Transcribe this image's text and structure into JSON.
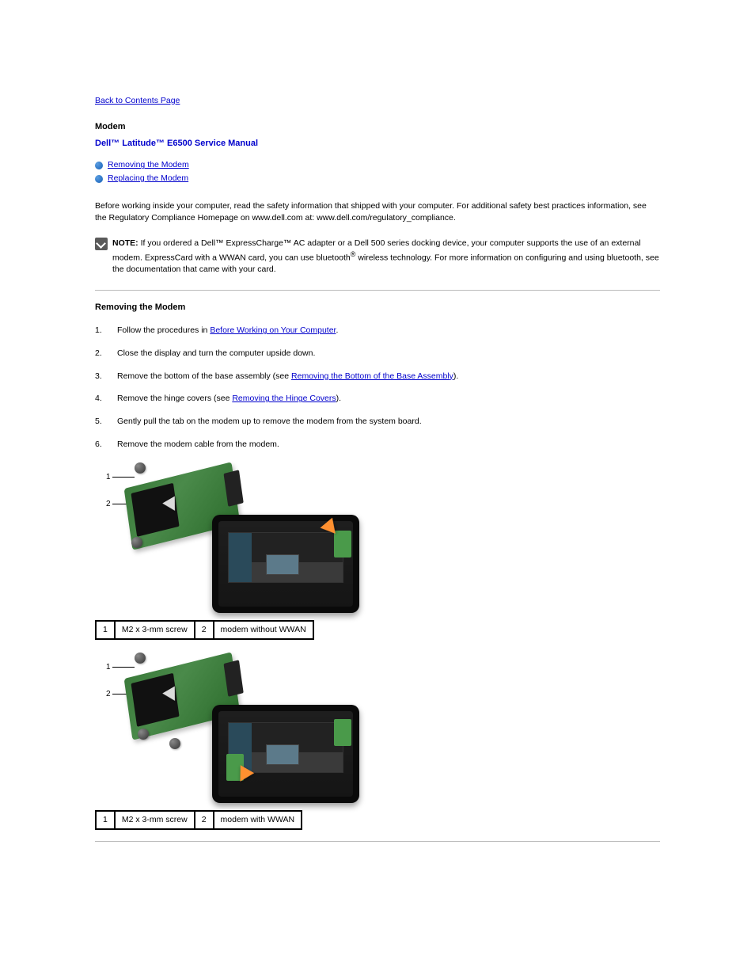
{
  "backLink": "Back to Contents Page",
  "heading": "Modem",
  "manualTitle": "Dell™ Latitude™ E6500 Service Manual",
  "toc": [
    {
      "label": "Removing the Modem"
    },
    {
      "label": "Replacing the Modem"
    }
  ],
  "intro": "Before working inside your computer, read the safety information that shipped with your computer. For additional safety best practices information, see the Regulatory Compliance Homepage on www.dell.com at: www.dell.com/regulatory_compliance.",
  "noteLabel": "NOTE:",
  "noteText1": " If you ordered a Dell™ ExpressCharge™ AC adapter or a Dell 500 series docking device, your computer supports the use of an external modem. ",
  "noteText2": "ExpressCard",
  "noteText3": " with a WWAN card, you can use bluetooth",
  "regMark": "®",
  "noteText4": " wireless technology. For more information on configuring and using bluetooth, see the documentation that came with your card.",
  "section1": "Removing the Modem",
  "steps": [
    {
      "num": "1.",
      "before": "Follow the procedures in ",
      "link": "Before Working on Your Computer",
      "after": "."
    },
    {
      "num": "2.",
      "before": "Close the display and turn the computer upside down.",
      "link": "",
      "after": ""
    },
    {
      "num": "3.",
      "before": "Remove the bottom of the base assembly (see ",
      "link": "Removing the Bottom of the Base Assembly",
      "after": ")."
    },
    {
      "num": "4.",
      "before": "Remove the hinge covers (see ",
      "link": "Removing the Hinge Covers",
      "after": ")."
    },
    {
      "num": "5.",
      "before": "Gently pull the tab on the modem up to remove the modem from the system board.",
      "link": "",
      "after": ""
    },
    {
      "num": "6.",
      "before": "Remove the modem cable from the modem.",
      "link": "",
      "after": ""
    }
  ],
  "table1": {
    "c1": "1",
    "l1": "M2 x 3-mm screw",
    "c2": "2",
    "l2": "modem without WWAN"
  },
  "table2": {
    "c1": "1",
    "l1": "M2 x 3-mm screw",
    "c2": "2",
    "l2": "modem with WWAN"
  }
}
